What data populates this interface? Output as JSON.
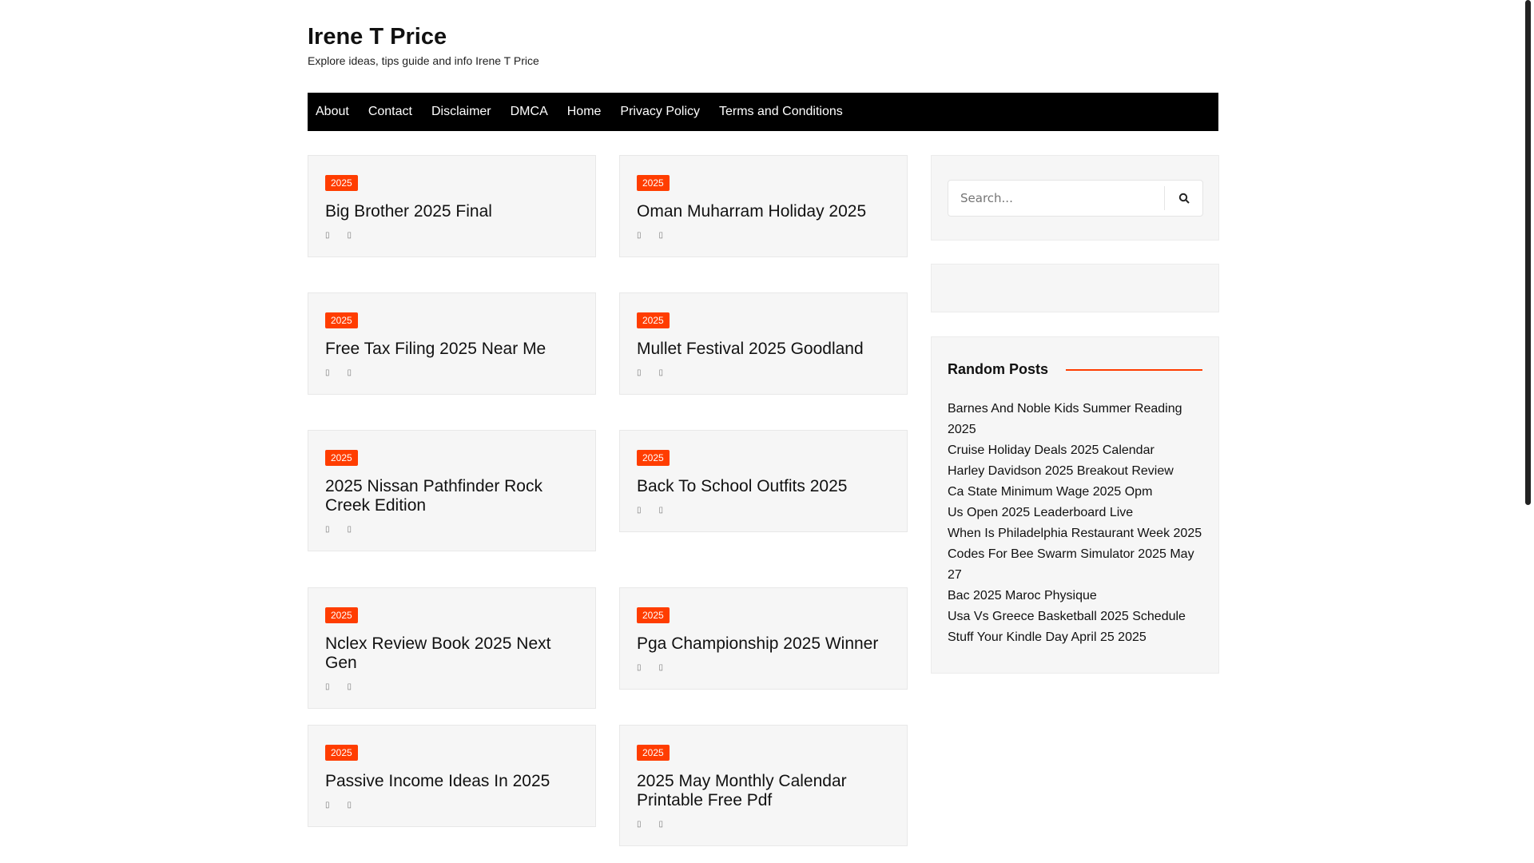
{
  "site": {
    "title": "Irene T Price",
    "description": "Explore ideas, tips guide and info Irene T Price"
  },
  "nav": [
    {
      "label": "About"
    },
    {
      "label": "Contact"
    },
    {
      "label": "Disclaimer"
    },
    {
      "label": "DMCA"
    },
    {
      "label": "Home"
    },
    {
      "label": "Privacy Policy"
    },
    {
      "label": "Terms and Conditions"
    }
  ],
  "posts": [
    {
      "category": "2025",
      "title": "Big Brother 2025 Final"
    },
    {
      "category": "2025",
      "title": "Oman Muharram Holiday 2025"
    },
    {
      "category": "2025",
      "title": "Free Tax Filing 2025 Near Me"
    },
    {
      "category": "2025",
      "title": "Mullet Festival 2025 Goodland"
    },
    {
      "category": "2025",
      "title": "2025 Nissan Pathfinder Rock Creek Edition"
    },
    {
      "category": "2025",
      "title": "Back To School Outfits 2025"
    },
    {
      "category": "2025",
      "title": "Nclex Review Book 2025 Next Gen"
    },
    {
      "category": "2025",
      "title": "Pga Championship 2025 Winner"
    },
    {
      "category": "2025",
      "title": "Passive Income Ideas In 2025"
    },
    {
      "category": "2025",
      "title": "2025 May Monthly Calendar Printable Free Pdf"
    }
  ],
  "meta_glyphs": {
    "date": "▯",
    "author": "▯"
  },
  "search": {
    "placeholder": "Search..."
  },
  "random_posts": {
    "heading": "Random Posts",
    "items": [
      "Barnes And Noble Kids Summer Reading 2025",
      "Cruise Holiday Deals 2025 Calendar",
      "Harley Davidson 2025 Breakout Review",
      "Ca State Minimum Wage 2025 Opm",
      "Us Open 2025 Leaderboard Live",
      "When Is Philadelphia Restaurant Week 2025",
      "Codes For Bee Swarm Simulator 2025 May 27",
      "Bac 2025 Maroc Physique",
      "Usa Vs Greece Basketball 2025 Schedule",
      "Stuff Your Kindle Day April 25 2025"
    ]
  },
  "colors": {
    "accent": "#ff3d00",
    "nav_bg": "#000000",
    "card_bg": "#f6f6f6"
  }
}
